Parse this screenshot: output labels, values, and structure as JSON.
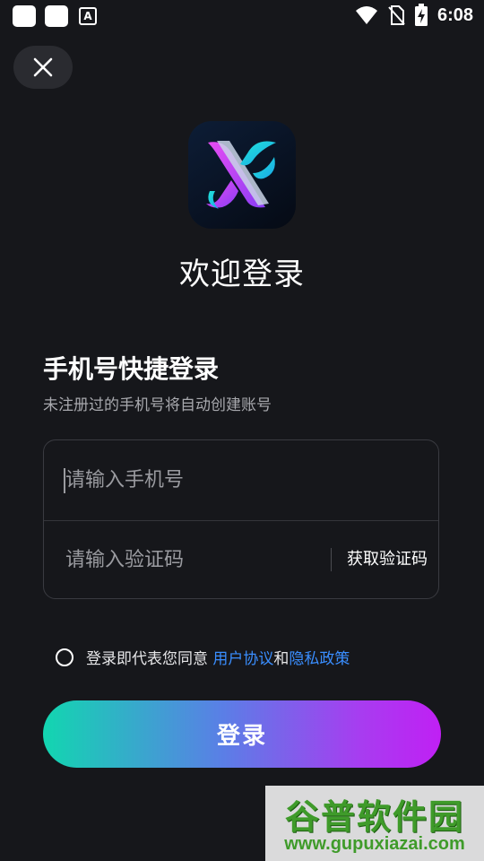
{
  "status_bar": {
    "a_icon_letter": "A",
    "time": "6:08"
  },
  "header": {
    "close_icon": "close-icon"
  },
  "welcome": {
    "title": "欢迎登录"
  },
  "login_section": {
    "title": "手机号快捷登录",
    "subtitle": "未注册过的手机号将自动创建账号"
  },
  "form": {
    "phone_placeholder": "请输入手机号",
    "phone_value": "",
    "code_placeholder": "请输入验证码",
    "code_value": "",
    "get_code_label": "获取验证码"
  },
  "agreement": {
    "prefix": "登录即代表您同意 ",
    "user_agreement": "用户协议",
    "conjunction": "和",
    "privacy_policy": "隐私政策",
    "checked": false
  },
  "login_button": {
    "label": "登录"
  },
  "watermark": {
    "title": "谷普软件园",
    "url": "www.gupuxiazai.com"
  },
  "colors": {
    "background": "#16171b",
    "link": "#3a8eff",
    "button_gradient_start": "#12d6b0",
    "button_gradient_end": "#c020f4"
  }
}
